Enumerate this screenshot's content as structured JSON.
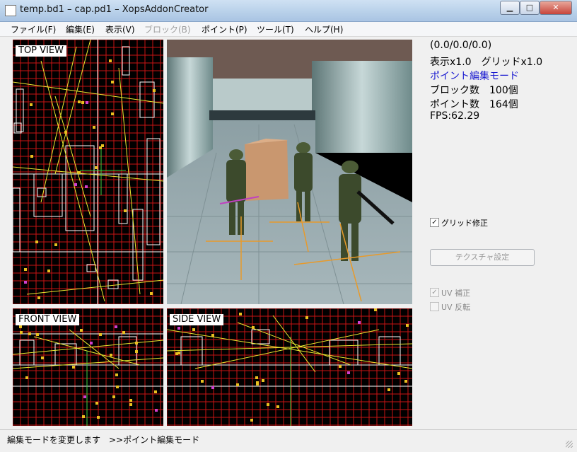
{
  "window": {
    "title": "temp.bd1 – cap.pd1 – XopsAddonCreator",
    "minimize": "▁",
    "maximize": "□",
    "close": "✕"
  },
  "menu": [
    {
      "label": "ファイル(F)",
      "enabled": true
    },
    {
      "label": "編集(E)",
      "enabled": true
    },
    {
      "label": "表示(V)",
      "enabled": true
    },
    {
      "label": "ブロック(B)",
      "enabled": false
    },
    {
      "label": "ポイント(P)",
      "enabled": true
    },
    {
      "label": "ツール(T)",
      "enabled": true
    },
    {
      "label": "ヘルプ(H)",
      "enabled": true
    }
  ],
  "views": {
    "top": "TOP VIEW",
    "front": "FRONT VIEW",
    "side": "SIDE VIEW"
  },
  "info": {
    "coords": "(0.0/0.0/0.0)",
    "zoom": "表示x1.0　グリッドx1.0",
    "mode": "ポイント編集モード",
    "blocks": "ブロック数　100個",
    "points": "ポイント数　164個",
    "fps": "FPS:62.29"
  },
  "controls": {
    "grid_fix": {
      "label": "グリッド修正",
      "checked": true
    },
    "texture_button": "テクスチャ設定",
    "uv_fix": {
      "label": "UV 補正",
      "checked": true,
      "enabled": false
    },
    "uv_flip": {
      "label": "UV 反転",
      "checked": false,
      "enabled": false
    }
  },
  "status": "編集モードを変更します　>>ポイント編集モード",
  "colors": {
    "grid": "#c81414",
    "wire": "#ffffff",
    "path": "#e8e830",
    "point": "#e8c020",
    "mode_text": "#1a1ad0"
  }
}
